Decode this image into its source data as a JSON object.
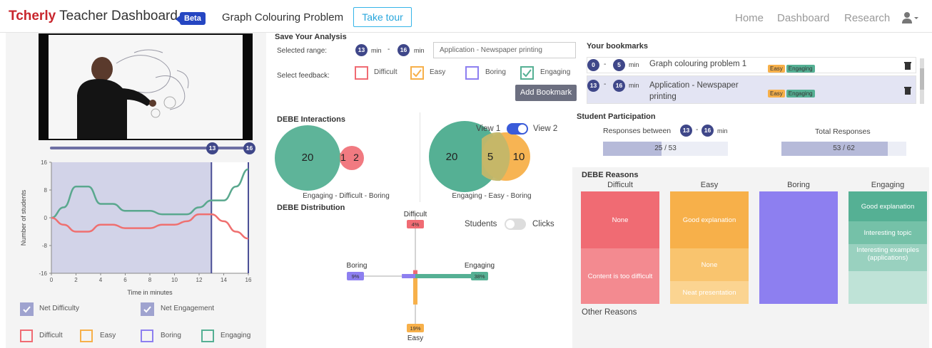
{
  "header": {
    "brand_part1": "Tcherly",
    "brand_part2": "Teacher Dashboard",
    "badge": "Beta",
    "subtitle": "Graph Colouring Problem",
    "tour_button": "Take tour",
    "nav": [
      "Home",
      "Dashboard",
      "Research"
    ],
    "user_icon": "user-icon"
  },
  "video": {
    "seek_start": "13",
    "seek_end": "16"
  },
  "line_chart": {
    "chart_data": {
      "type": "line",
      "x": [
        0,
        1,
        2,
        3,
        4,
        5,
        6,
        7,
        8,
        9,
        10,
        11,
        12,
        13,
        14,
        15,
        16
      ],
      "xlabel": "Time in minutes",
      "ylabel": "Number of students",
      "xticks": [
        "0",
        "2",
        "4",
        "6",
        "8",
        "10",
        "12",
        "14",
        "16"
      ],
      "yticks": [
        "16",
        "8",
        "0",
        "-8",
        "-16"
      ],
      "ylim": [
        -16,
        16
      ],
      "xlim": [
        0,
        16
      ],
      "selected_range": [
        13,
        16
      ],
      "series": [
        {
          "key": "engagement",
          "color": "#5aa88e",
          "values": [
            0,
            3,
            9,
            9,
            4,
            4,
            2,
            2,
            2,
            1,
            1,
            1,
            3,
            5,
            5,
            9,
            14
          ]
        },
        {
          "key": "difficulty",
          "color": "#ef7070",
          "values": [
            0,
            -2,
            -4,
            -4,
            -2,
            -2,
            -3,
            -3,
            -3,
            -2,
            -2,
            -1,
            1,
            1,
            -1,
            -4,
            -6
          ]
        }
      ]
    }
  },
  "legend_checks": [
    {
      "label": "Net Difficulty",
      "checked": true
    },
    {
      "label": "Net Engagement",
      "checked": true
    }
  ],
  "legend_colors": [
    {
      "label": "Difficult",
      "color": "#f06b73"
    },
    {
      "label": "Easy",
      "color": "#f7b04a"
    },
    {
      "label": "Boring",
      "color": "#8d7ff0"
    },
    {
      "label": "Engaging",
      "color": "#55b094"
    }
  ],
  "save": {
    "title": "Save Your Analysis",
    "range_label": "Selected range:",
    "start": "13",
    "end": "16",
    "min_unit": "min",
    "separator": "-",
    "note_value": "Application - Newspaper printing",
    "feedback_label": "Select feedback:",
    "options": [
      {
        "label": "Difficult",
        "color": "#f06b73",
        "checked": false
      },
      {
        "label": "Easy",
        "color": "#f7b04a",
        "checked": true
      },
      {
        "label": "Boring",
        "color": "#8d7ff0",
        "checked": false
      },
      {
        "label": "Engaging",
        "color": "#55b094",
        "checked": true
      }
    ],
    "add_button": "Add Bookmark"
  },
  "bookmarks": {
    "title": "Your bookmarks",
    "rows": [
      {
        "start": "0",
        "end": "5",
        "unit": "min",
        "text": "Graph colouring problem 1",
        "tags": [
          "Easy",
          "Engaging"
        ]
      },
      {
        "start": "13",
        "end": "16",
        "unit": "min",
        "text": "Application - Newspaper printing",
        "tags": [
          "Easy",
          "Engaging"
        ]
      }
    ],
    "delete_icon": "trash-icon"
  },
  "interactions": {
    "title": "DEBE Interactions",
    "venn1": {
      "a": "20",
      "overlap": "1",
      "b": "2",
      "caption": "Engaging - Difficult - Boring"
    },
    "venn2": {
      "a": "20",
      "overlap": "5",
      "b": "10",
      "caption": "Engaging - Easy - Boring"
    },
    "view1": "View 1",
    "view2": "View 2"
  },
  "distribution": {
    "title": "DEBE Distribution",
    "toggle_left": "Students",
    "toggle_right": "Clicks",
    "chart_data": {
      "type": "bar",
      "categories": [
        "Difficult",
        "Easy",
        "Boring",
        "Engaging"
      ],
      "values": [
        4,
        19,
        9,
        38
      ],
      "labels": [
        "4%",
        "19%",
        "9%",
        "38%"
      ]
    }
  },
  "participation": {
    "title": "Student Participation",
    "responses_between": "Responses between",
    "start": "13",
    "end": "16",
    "unit": "min",
    "range_value": "25 / 53",
    "range_fraction": 0.47,
    "total_label": "Total Responses",
    "total_value": "53 / 62",
    "total_fraction": 0.85
  },
  "reasons": {
    "title": "DEBE Reasons",
    "columns": [
      {
        "name": "Difficult",
        "items": [
          "None",
          "Content is too difficult"
        ]
      },
      {
        "name": "Easy",
        "items": [
          "Good explanation",
          "None",
          "Neat presentation"
        ]
      },
      {
        "name": "Boring",
        "items": []
      },
      {
        "name": "Engaging",
        "items": [
          "Good explanation",
          "Interesting topic",
          "Interesting examples (applications)"
        ]
      }
    ],
    "other": "Other Reasons"
  }
}
